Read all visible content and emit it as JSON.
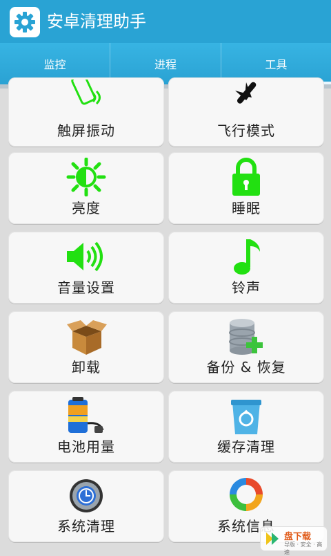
{
  "header": {
    "title": "安卓清理助手",
    "icon": "gear-icon"
  },
  "tabs": [
    {
      "label": "监控",
      "active": false
    },
    {
      "label": "进程",
      "active": false
    },
    {
      "label": "工具",
      "active": true
    }
  ],
  "tools": [
    {
      "label": "触屏振动",
      "icon": "vibrate-phone-icon"
    },
    {
      "label": "飞行模式",
      "icon": "airplane-icon"
    },
    {
      "label": "亮度",
      "icon": "brightness-icon"
    },
    {
      "label": "睡眠",
      "icon": "lock-icon"
    },
    {
      "label": "音量设置",
      "icon": "speaker-icon"
    },
    {
      "label": "铃声",
      "icon": "music-note-icon"
    },
    {
      "label": "卸载",
      "icon": "box-icon"
    },
    {
      "label": "备份 & 恢复",
      "icon": "database-add-icon"
    },
    {
      "label": "电池用量",
      "icon": "battery-icon"
    },
    {
      "label": "缓存清理",
      "icon": "recycle-bin-icon"
    },
    {
      "label": "系统清理",
      "icon": "clock-disc-icon"
    },
    {
      "label": "系统信息",
      "icon": "refresh-circle-icon"
    }
  ],
  "watermark": {
    "brand": "盘下载",
    "tagline": "导版 · 安全 · 高速",
    "icon": "fast-logo-icon"
  },
  "colors": {
    "accent": "#29a3d4",
    "icon_green": "#22e011"
  }
}
